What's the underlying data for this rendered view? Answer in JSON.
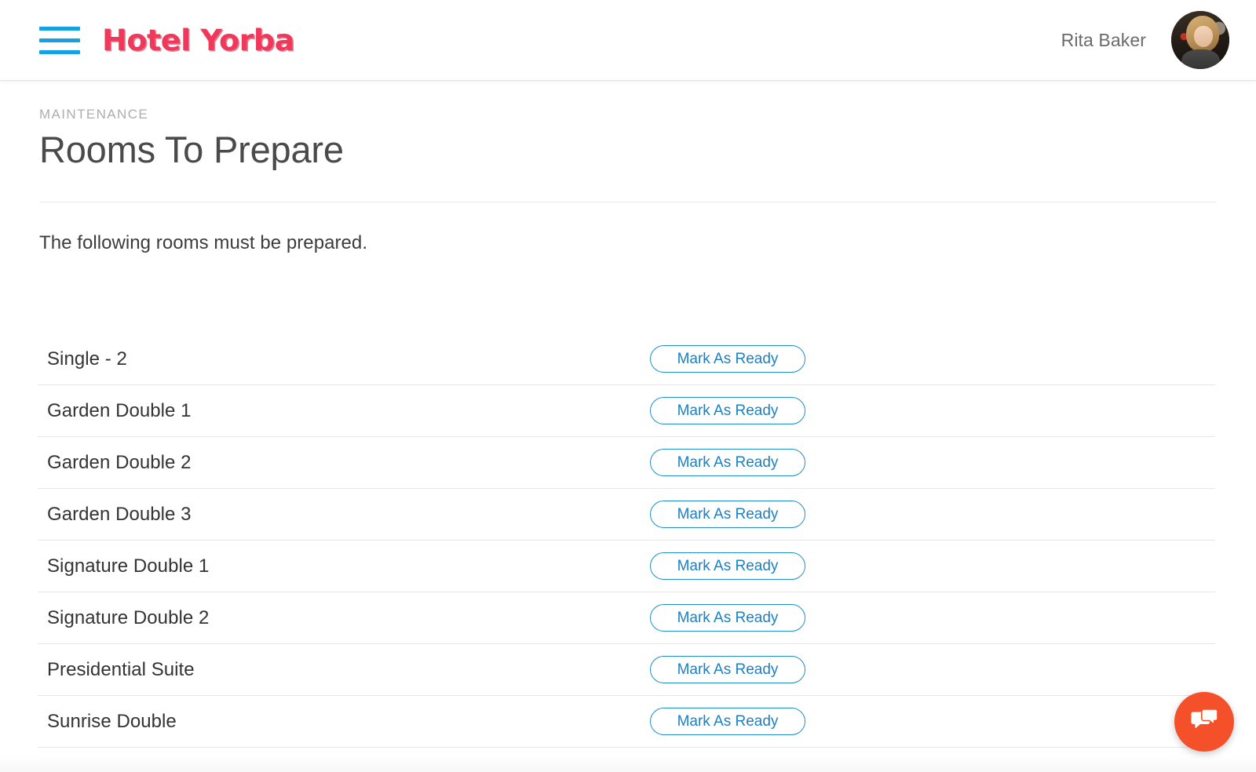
{
  "header": {
    "menu_icon": "hamburger-menu-icon",
    "brand": "Hotel Yorba",
    "user_name": "Rita Baker",
    "avatar_icon": "user-avatar-photo"
  },
  "page": {
    "eyebrow": "MAINTENANCE",
    "title": "Rooms To Prepare",
    "intro": "The following rooms must be prepared."
  },
  "rooms": [
    {
      "name": "Single - 2",
      "action": "Mark As Ready"
    },
    {
      "name": "Garden Double 1",
      "action": "Mark As Ready"
    },
    {
      "name": "Garden Double 2",
      "action": "Mark As Ready"
    },
    {
      "name": "Garden Double 3",
      "action": "Mark As Ready"
    },
    {
      "name": "Signature Double 1",
      "action": "Mark As Ready"
    },
    {
      "name": "Signature Double 2",
      "action": "Mark As Ready"
    },
    {
      "name": "Presidential Suite",
      "action": "Mark As Ready"
    },
    {
      "name": "Sunrise Double",
      "action": "Mark As Ready"
    }
  ],
  "chat_widget": {
    "icon": "chat-bubbles-icon"
  },
  "colors": {
    "brand_pink": "#f2385a",
    "menu_blue": "#15a2e0",
    "button_blue": "#1b81c3",
    "chat_orange": "#f4502a",
    "title_gray": "#4a4a4a",
    "eyebrow_gray": "#adadad",
    "divider_gray": "#e6e6e6",
    "background": "#ffffff"
  }
}
